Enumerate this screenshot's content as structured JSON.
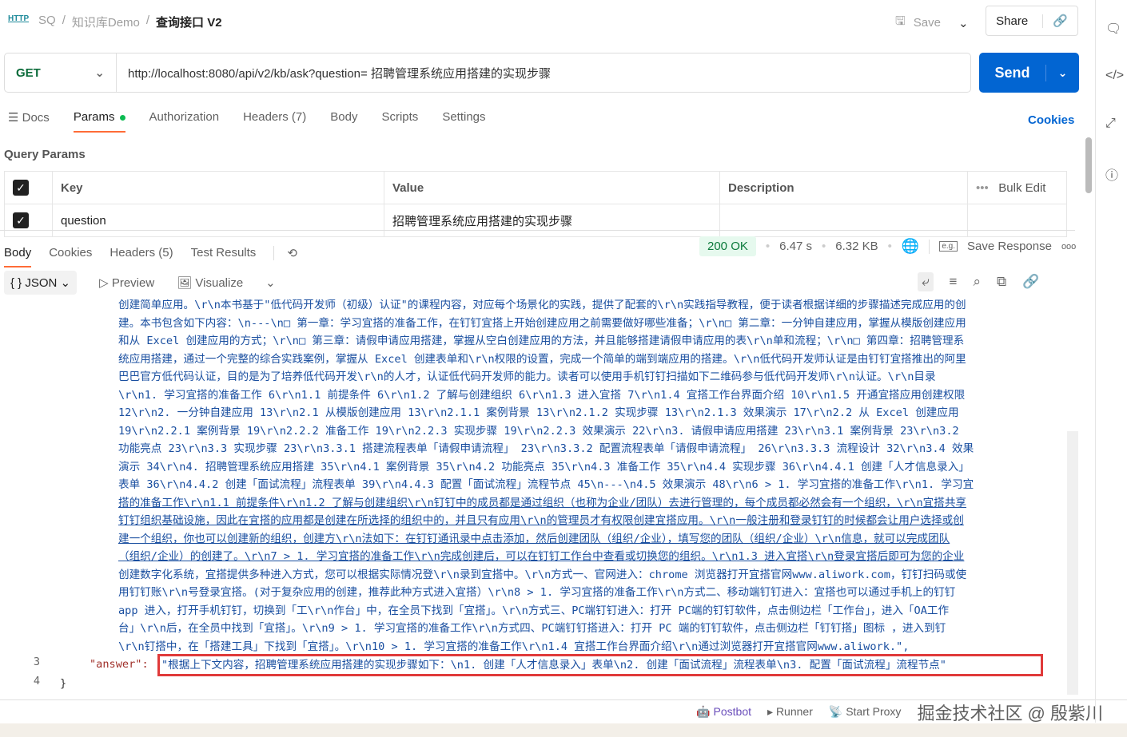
{
  "breadcrumb": {
    "icon": "HTTP",
    "items": [
      "SQ",
      "/",
      "知识库Demo",
      "/"
    ],
    "current": "查询接口 V2"
  },
  "header": {
    "save": "Save",
    "share": "Share"
  },
  "request": {
    "method": "GET",
    "url": "http://localhost:8080/api/v2/kb/ask?question= 招聘管理系统应用搭建的实现步骤",
    "send": "Send"
  },
  "tabs": [
    "Docs",
    "Params",
    "Authorization",
    "Headers (7)",
    "Body",
    "Scripts",
    "Settings"
  ],
  "cookies": "Cookies",
  "query_params": {
    "title": "Query Params",
    "headers": [
      "Key",
      "Value",
      "Description"
    ],
    "bulk_edit": "Bulk Edit",
    "rows": [
      {
        "key": "question",
        "value": "招聘管理系统应用搭建的实现步骤",
        "description": ""
      }
    ]
  },
  "response": {
    "tabs": [
      "Body",
      "Cookies",
      "Headers (5)",
      "Test Results"
    ],
    "status": "200 OK",
    "time": "6.47 s",
    "size": "6.32 KB",
    "save_response": "Save Response",
    "format": "JSON",
    "preview": "Preview",
    "visualize": "Visualize"
  },
  "body_lines": [
    "创建简单应用。\\r\\n本书基于\"低代码开发师（初级）认证\"的课程内容，对应每个场景化的实践，提供了配套的\\r\\n实践指导教程，便于读者根据详细的步骤描述完成应用的创",
    "建。本书包含如下内容：\\n---\\n□ 第一章：学习宜搭的准备工作，在钉钉宜搭上开始创建应用之前需要做好哪些准备；\\r\\n□ 第二章：一分钟自建应用，掌握从模版创建应用",
    "和从 Excel 创建应用的方式；\\r\\n□ 第三章：请假申请应用搭建，掌握从空白创建应用的方法，并且能够搭建请假申请应用的表\\r\\n单和流程；\\r\\n□ 第四章：招聘管理系",
    "统应用搭建，通过一个完整的综合实践案例，掌握从 Excel 创建表单和\\r\\n权限的设置，完成一个简单的端到端应用的搭建。\\r\\n低代码开发师认证是由钉钉宜搭推出的阿里",
    "巴巴官方低代码认证，目的是为了培养低代码开发\\r\\n的人才，认证低代码开发师的能力。读者可以使用手机钉钉扫描如下二维码参与低代码开发师\\r\\n认证。\\r\\n目录",
    "\\r\\n1. 学习宜搭的准备工作 6\\r\\n1.1 前提条件 6\\r\\n1.2 了解与创建组织 6\\r\\n1.3 进入宜搭 7\\r\\n1.4 宜搭工作台界面介绍 10\\r\\n1.5 开通宜搭应用创建权限",
    "12\\r\\n2. 一分钟自建应用 13\\r\\n2.1 从模版创建应用 13\\r\\n2.1.1 案例背景 13\\r\\n2.1.2 实现步骤 13\\r\\n2.1.3 效果演示 17\\r\\n2.2 从 Excel 创建应用",
    "19\\r\\n2.2.1 案例背景 19\\r\\n2.2.2 准备工作 19\\r\\n2.2.3 实现步骤 19\\r\\n2.2.3 效果演示 22\\r\\n3. 请假申请应用搭建 23\\r\\n3.1 案例背景 23\\r\\n3.2",
    "功能亮点 23\\r\\n3.3 实现步骤 23\\r\\n3.3.1 搭建流程表单「请假申请流程」 23\\r\\n3.3.2 配置流程表单「请假申请流程」 26\\r\\n3.3.3 流程设计 32\\r\\n3.4 效果",
    "演示 34\\r\\n4. 招聘管理系统应用搭建 35\\r\\n4.1 案例背景 35\\r\\n4.2 功能亮点 35\\r\\n4.3 准备工作 35\\r\\n4.4 实现步骤 36\\r\\n4.4.1 创建「人才信息录入」",
    "表单 36\\r\\n4.4.2 创建「面试流程」流程表单 39\\r\\n4.4.3 配置「面试流程」流程节点 45\\n---\\n4.5 效果演示 48\\r\\n6 > 1. 学习宜搭的准备工作\\r\\n1. 学习宜",
    "搭的准备工作\\r\\n1.1 前提条件\\r\\n1.2 了解与创建组织\\r\\n钉钉中的成员都是通过组织（也称为企业/团队）去进行管理的，每个成员都必然会有一个组织，\\r\\n宜搭共享",
    "钉钉组织基础设施，因此在宜搭的应用都是创建在所选择的组织中的，并且只有应用\\r\\n的管理员才有权限创建宜搭应用。\\r\\n一般注册和登录钉钉的时候都会让用户选择或创",
    "建一个组织，你也可以创建新的组织，创建方\\r\\n法如下：在钉钉通讯录中点击添加，然后创建团队（组织/企业），填写您的团队（组织/企业）\\r\\n信息，就可以完成团队",
    "（组织/企业）的创建了。\\r\\n7 > 1. 学习宜搭的准备工作\\r\\n完成创建后，可以在钉钉工作台中查看或切换您的组织。\\r\\n1.3 进入宜搭\\r\\n登录宜搭后即可为您的企业",
    "创建数字化系统，宜搭提供多种进入方式，您可以根据实际情况登\\r\\n录到宜搭中。\\r\\n方式一、官网进入：chrome 浏览器打开宜搭官网www.aliwork.com，钉钉扫码或使",
    "用钉钉账\\r\\n号登录宜搭。(对于复杂应用的创建，推荐此种方式进入宜搭）\\r\\n8 > 1. 学习宜搭的准备工作\\r\\n方式二、移动端钉钉进入：宜搭也可以通过手机上的钉钉",
    "app 进入，打开手机钉钉，切换到「工\\r\\n作台」中，在全员下找到「宜搭」。\\r\\n方式三、PC端钉钉进入：打开 PC端的钉钉软件，点击侧边栏「工作台」，进入「OA工作",
    "台」\\r\\n后，在全员中找到「宜搭」。\\r\\n9 > 1. 学习宜搭的准备工作\\r\\n方式四、PC端钉钉搭进入：打开 PC 端的钉钉软件，点击侧边栏「钉钉搭」图标 ，进入到钉",
    "\\r\\n钉搭中，在「搭建工具」下找到「宜搭」。\\r\\n10 > 1. 学习宜搭的准备工作\\r\\n1.4 宜搭工作台界面介绍\\r\\n通过浏览器打开宜搭官网www.aliwork.\","
  ],
  "answer_line": {
    "num3": "3",
    "num4": "4",
    "key": "\"answer\":",
    "value": "\"根据上下文内容，招聘管理系统应用搭建的实现步骤如下：\\n1. 创建「人才信息录入」表单\\n2. 创建「面试流程」流程表单\\n3. 配置「面试流程」流程节点\"",
    "close": "}"
  },
  "footer": [
    "Postbot",
    "Runner",
    "Start Proxy"
  ],
  "watermark": "掘金技术社区 @ 殷紫川"
}
